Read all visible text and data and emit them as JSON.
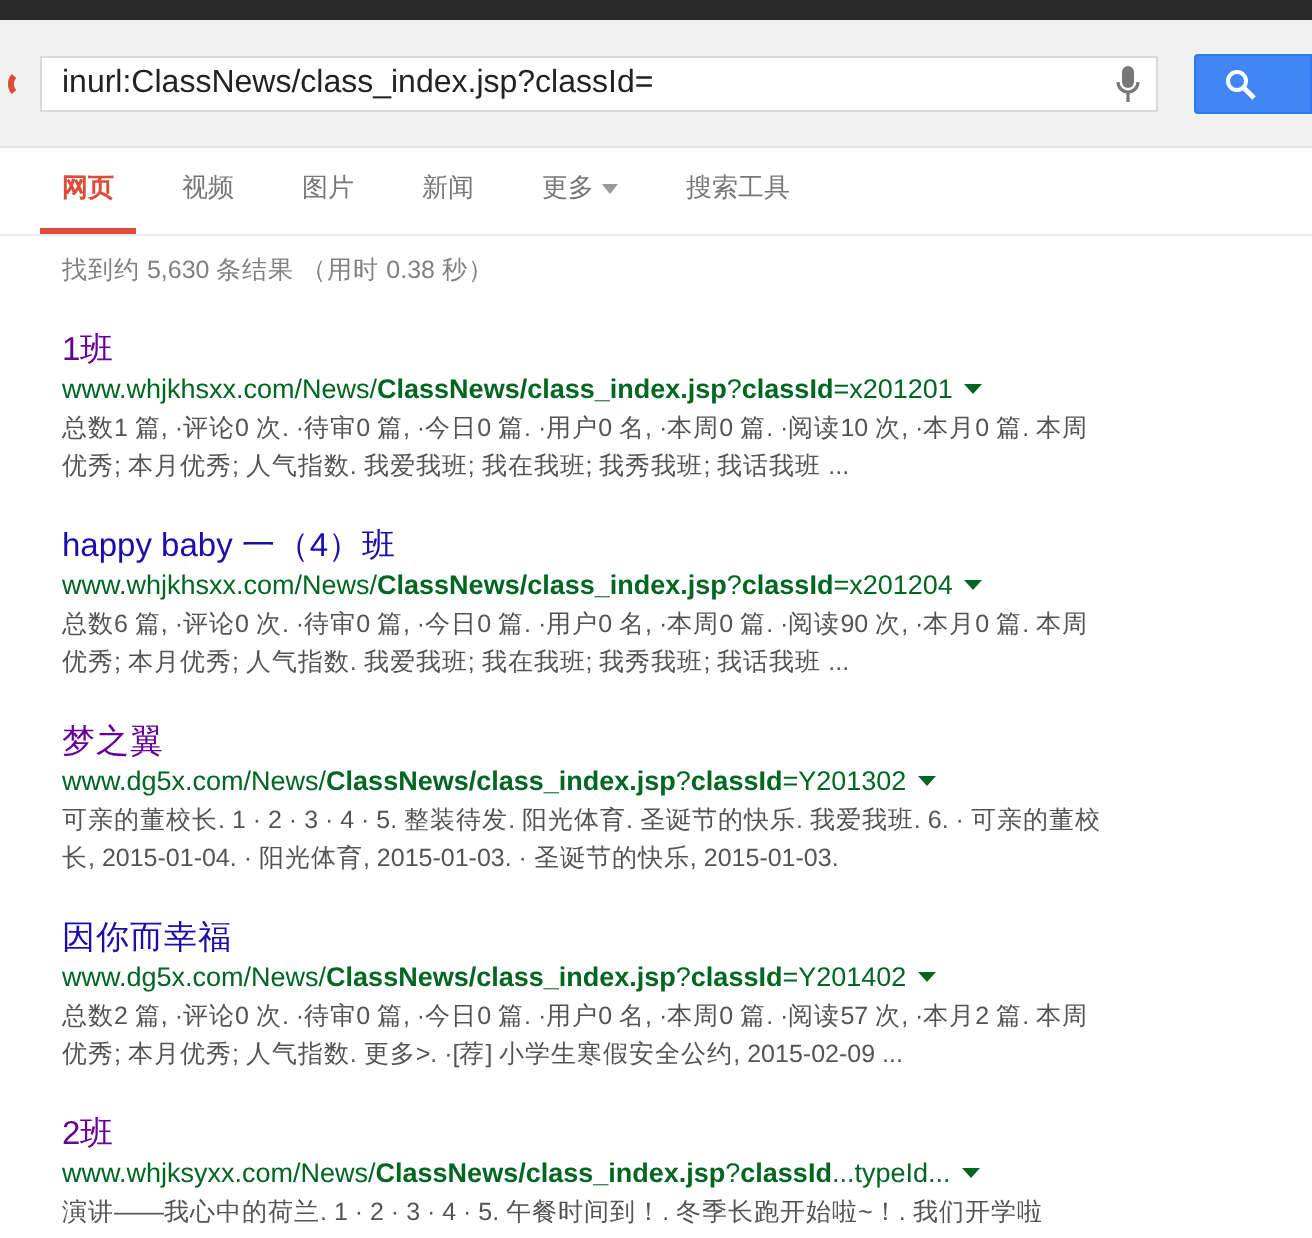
{
  "search": {
    "value": "inurl:ClassNews/class_index.jsp?classId="
  },
  "tabs": [
    {
      "label": "网页",
      "selected": true,
      "dropdown": false
    },
    {
      "label": "视频",
      "selected": false,
      "dropdown": false
    },
    {
      "label": "图片",
      "selected": false,
      "dropdown": false
    },
    {
      "label": "新闻",
      "selected": false,
      "dropdown": false
    },
    {
      "label": "更多",
      "selected": false,
      "dropdown": true
    },
    {
      "label": "搜索工具",
      "selected": false,
      "dropdown": false
    }
  ],
  "result_stats": "找到约 5,630 条结果 （用时 0.38 秒）",
  "results": [
    {
      "title": "1班",
      "visited": true,
      "url": "www.whjkhsxx.com/News/**ClassNews/class_index.jsp**?**classId**=x201201",
      "snippet": "总数1 篇, ·评论0 次. ·待审0 篇, ·今日0 篇. ·用户0 名, ·本周0 篇. ·阅读10 次, ·本月0 篇. 本周优秀; 本月优秀; 人气指数. 我爱我班; 我在我班; 我秀我班; 我话我班 ..."
    },
    {
      "title": "happy baby 一（4）班",
      "visited": false,
      "url": "www.whjkhsxx.com/News/**ClassNews/class_index.jsp**?**classId**=x201204",
      "snippet": "总数6 篇, ·评论0 次. ·待审0 篇, ·今日0 篇. ·用户0 名, ·本周0 篇. ·阅读90 次, ·本月0 篇. 本周优秀; 本月优秀; 人气指数. 我爱我班; 我在我班; 我秀我班; 我话我班 ..."
    },
    {
      "title": "梦之翼",
      "visited": true,
      "url": "www.dg5x.com/News/**ClassNews/class_index.jsp**?**classId**=Y201302",
      "snippet": "可亲的董校长. 1 · 2 · 3 · 4 · 5. 整装待发. 阳光体育. 圣诞节的快乐. 我爱我班. 6. · 可亲的董校长, 2015-01-04. · 阳光体育, 2015-01-03. · 圣诞节的快乐, 2015-01-03."
    },
    {
      "title": "因你而幸福",
      "visited": false,
      "url": "www.dg5x.com/News/**ClassNews/class_index.jsp**?**classId**=Y201402",
      "snippet": "总数2 篇, ·评论0 次. ·待审0 篇, ·今日0 篇. ·用户0 名, ·本周0 篇. ·阅读57 次, ·本月2 篇. 本周优秀; 本月优秀; 人气指数. 更多>. ·[荐] 小学生寒假安全公约, 2015-02-09 ..."
    },
    {
      "title": "2班",
      "visited": true,
      "url": "www.whjksyxx.com/News/**ClassNews/class_index.jsp**?**classId**...typeId...",
      "snippet": "演讲——我心中的荷兰. 1 · 2 · 3 · 4 · 5. 午餐时间到！. 冬季长跑开始啦~！. 我们开学啦"
    }
  ]
}
